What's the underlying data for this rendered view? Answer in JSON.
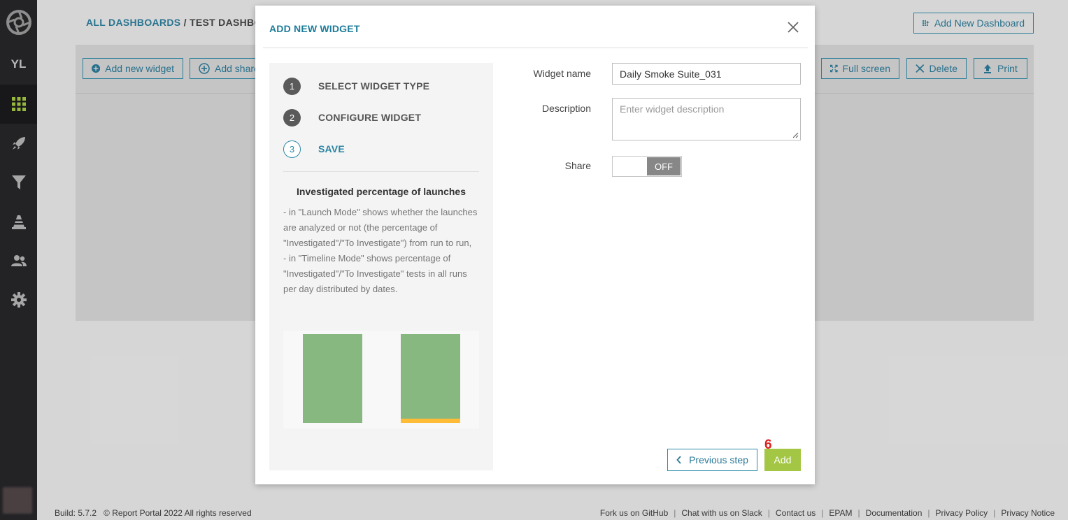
{
  "sidebar": {
    "user_initials": "YL",
    "items": [
      {
        "icon": "dashboard-grid-icon",
        "active": true
      },
      {
        "icon": "rocket-icon",
        "active": false
      },
      {
        "icon": "filter-icon",
        "active": false
      },
      {
        "icon": "debug-cone-icon",
        "active": false
      },
      {
        "icon": "members-icon",
        "active": false
      },
      {
        "icon": "settings-gear-icon",
        "active": false
      }
    ]
  },
  "header": {
    "breadcrumb_root": "ALL DASHBOARDS",
    "breadcrumb_separator": "/",
    "breadcrumb_current": "TEST DASHBOAR",
    "add_dashboard_label": "Add New Dashboard"
  },
  "toolbar": {
    "add_widget_label": "Add new widget",
    "add_shared_label": "Add share",
    "fullscreen_label": "Full screen",
    "delete_label": "Delete",
    "print_label": "Print"
  },
  "modal": {
    "title": "ADD NEW WIDGET",
    "steps": [
      {
        "number": "1",
        "label": "SELECT WIDGET TYPE",
        "state": "done"
      },
      {
        "number": "2",
        "label": "CONFIGURE WIDGET",
        "state": "done"
      },
      {
        "number": "3",
        "label": "SAVE",
        "state": "current"
      }
    ],
    "widget_type_title": "Investigated percentage of launches",
    "widget_type_description_lines": [
      "- in \"Launch Mode\" shows whether the launches are analyzed or not (the percentage of \"Investigated\"/\"To Investigate\") from run to run,",
      "- in \"Timeline Mode\" shows percentage of \"Investigated\"/\"To Investigate\" tests in all runs per day distributed by dates."
    ],
    "preview_colors": {
      "investigated": "#87b87f",
      "to_investigate": "#ffbc37"
    },
    "form": {
      "widget_name_label": "Widget name",
      "widget_name_value": "Daily Smoke Suite_031",
      "description_label": "Description",
      "description_placeholder": "Enter widget description",
      "share_label": "Share",
      "share_state": "OFF"
    },
    "previous_step_label": "Previous step",
    "add_label": "Add",
    "step_annotation": "6"
  },
  "footer": {
    "build": "Build: 5.7.2",
    "copyright": "© Report Portal 2022 All rights reserved",
    "links": [
      "Fork us on GitHub",
      "Chat with us on Slack",
      "Contact us",
      "EPAM",
      "Documentation",
      "Privacy Policy",
      "Privacy Notice"
    ]
  },
  "colors": {
    "accent": "#2e8aa8",
    "add_button": "#a3c644",
    "sidebar": "#26262a",
    "active_icon": "#a3c644"
  }
}
